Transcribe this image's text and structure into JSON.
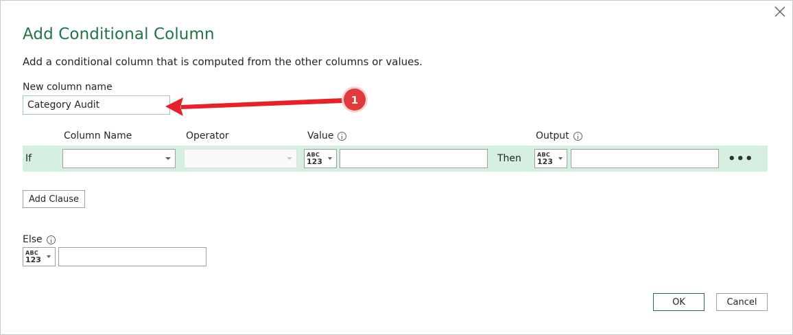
{
  "dialog": {
    "title": "Add Conditional Column",
    "subtitle": "Add a conditional column that is computed from the other columns or values.",
    "close_icon": "close-icon"
  },
  "name_field": {
    "label": "New column name",
    "value": "Category Audit"
  },
  "headers": {
    "column_name": "Column Name",
    "operator": "Operator",
    "value": "Value",
    "output": "Output"
  },
  "clause": {
    "if_label": "If",
    "then_label": "Then",
    "column_name_value": "",
    "operator_value": "",
    "value_type_top": "ABC",
    "value_type_bottom": "123",
    "value_text": "",
    "output_type_top": "ABC",
    "output_type_bottom": "123",
    "output_text": "",
    "more_label": "•••"
  },
  "add_clause_label": "Add Clause",
  "else": {
    "label": "Else",
    "type_top": "ABC",
    "type_bottom": "123",
    "value": ""
  },
  "footer": {
    "ok_label": "OK",
    "cancel_label": "Cancel"
  },
  "annotation": {
    "badge_number": "1",
    "badge_color": "#e03a3a",
    "arrow_color": "#e8202a"
  },
  "colors": {
    "accent": "#217346",
    "row_background": "#d5efe0"
  }
}
